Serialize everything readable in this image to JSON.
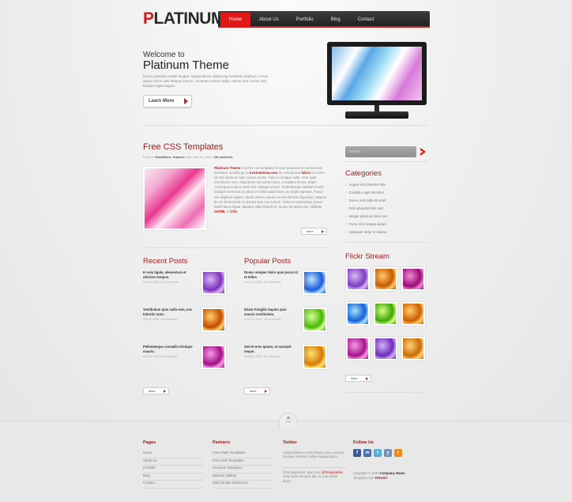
{
  "brand": {
    "logo_first": "P",
    "logo_rest": "LATINUM",
    "accent": "#d11c1c"
  },
  "nav": [
    "Home",
    "About Us",
    "Portfolio",
    "Blog",
    "Contact"
  ],
  "hero": {
    "subtitle": "Welcome to",
    "title": "Platinum Theme",
    "text": "Donec pulvinar mattis feugiat. Suspendisse adipiscing hendrerit dapibus. Fusce auctor nisl a velit tempus rutrum. Vivamus mauris nulla, rutrum sed cursus sed, tempus eget magna.",
    "button": "Learn More"
  },
  "post": {
    "title": "Free CSS Templates",
    "meta_prefix": "Posted in",
    "meta_cat1": "Illustrations",
    "meta_cat2": "Graphics",
    "meta_mid": "Date: June 3rd, 2009 |",
    "meta_comments": "108 comments",
    "body_lead": "Platinum Theme",
    "body_1": "is a free css template for your personal or commercial websites. Credits go to",
    "body_link1": "trustmeimsa.com",
    "body_2": "for visuals and",
    "body_link2": "fabric",
    "body_3": "for icons. Ut sed lorem ac ante cursus auctor. Nam ut congue nulla. Cras eget fermentum sem. Maecenas nec porta lorem, a sodales lectus. Etiam consequat nulla at amet nisi volutpat ornare. Pellentesque habitant morbi tristique senectus et netus et malesuada fames ac turpis egestas. Fusce nec dapibus sapien. Morbi viverra mauris ut erat ultricies dignissim. Mauris leo ac fermentum ex viverra sem non rutrum. Nulla et consectetur purus. Morbi lacus ligula, dapibus vitae blandit et, auctor sit amet erat. Validate",
    "body_link3": "XHTML",
    "body_and": "&",
    "body_link4": "CSS",
    "body_end": ".",
    "more": "More"
  },
  "recent": {
    "title": "Recent Posts",
    "items": [
      {
        "title": "In sem ligula, elementum et ultricies tempus.",
        "date": "Feb 25, 2009 | 105 comments",
        "c1": "#d9b8ef",
        "c2": "#7d2fbd"
      },
      {
        "title": "Vestibulum quis nulla sem, nec lobortis nunc.",
        "date": "Feb 25, 2009 | 94 comments",
        "c1": "#ffd36b",
        "c2": "#c44a00"
      },
      {
        "title": "Pellentesque convallis tristique mauris.",
        "date": "Feb 18, 2009 | 58 comments",
        "c1": "#f5a0e4",
        "c2": "#a30d88"
      }
    ],
    "more": "More"
  },
  "popular": {
    "title": "Popular Posts",
    "items": [
      {
        "title": "Donec semper dolor quis purus id et tellus.",
        "date": "June 23, 2009 | 150 comments",
        "c1": "#bfe6ff",
        "c2": "#1a5ad8"
      },
      {
        "title": "Etiam Fringilla Sapien quis mauris vestibulum.",
        "date": "June 16, 2009 | 155 comments",
        "c1": "#d7ff9a",
        "c2": "#49b800"
      },
      {
        "title": "Sed et eros ipsum, ut suscipit neque.",
        "date": "June 08, 2009 | 167 comments",
        "c1": "#ffe27a",
        "c2": "#d67b00"
      }
    ],
    "more": "More"
  },
  "sidebar": {
    "search_placeholder": "Search",
    "categories_title": "Categories",
    "categories": [
      "Augue fele pharetra felis",
      "Curabitur eget tincidunt",
      "Donec sed nulla sit amet",
      "Felis pharetra felis sed",
      "Integer placerat dolor nisl",
      "Tortor mi in massa donec",
      "Vulputate tortor in massa"
    ],
    "flickr_title": "Flickr Stream",
    "flickr": [
      {
        "c1": "#d8b9f0",
        "c2": "#7a3cc0"
      },
      {
        "c1": "#ffc86a",
        "c2": "#c45a00"
      },
      {
        "c1": "#f28ad5",
        "c2": "#9a0b72"
      },
      {
        "c1": "#a7e1ff",
        "c2": "#1560d4"
      },
      {
        "c1": "#d4ff8a",
        "c2": "#3fa600"
      },
      {
        "c1": "#ffcf6b",
        "c2": "#cc5d00"
      },
      {
        "c1": "#f79ae1",
        "c2": "#a4138a"
      },
      {
        "c1": "#cfb2f1",
        "c2": "#6f2bbf"
      },
      {
        "c1": "#ffd27a",
        "c2": "#c86a00"
      }
    ],
    "more": "More"
  },
  "footer": {
    "top_label": "TOP",
    "pages_title": "Pages",
    "pages": [
      "Home",
      "About Us",
      "Portfolio",
      "Blog",
      "Contact"
    ],
    "partners_title": "Partners",
    "partners": [
      "Free Flash Templates",
      "Free CSS Templates",
      "Premium Templates",
      "Website Gallery",
      "Web Design Resources"
    ],
    "twitter_title": "Twitter",
    "tweet1": "Suspendisse et scelerisque urna. Aenean tincidunt metus in tellus suscipit dolor.",
    "tweet2_a": "Proin dignissim, diam nec",
    "tweet2_handle": "@TemplateMo",
    "tweet2_b": "enim lorem tempus dui, ac ante porta lorem.",
    "follow_title": "Follow Us",
    "social": [
      {
        "name": "facebook",
        "glyph": "f",
        "color": "#3b5998"
      },
      {
        "name": "myspace",
        "glyph": "m",
        "color": "#4b6ca8"
      },
      {
        "name": "twitter",
        "glyph": "t",
        "color": "#4fb0de"
      },
      {
        "name": "youtube",
        "glyph": "y",
        "color": "#6f8fb5"
      },
      {
        "name": "rss",
        "glyph": "r",
        "color": "#f08a1d"
      }
    ],
    "copy_a": "Copyright © 2048",
    "copy_name": "Company Name",
    "copy_b": "Template from",
    "copy_tm": "PIXUSS"
  }
}
